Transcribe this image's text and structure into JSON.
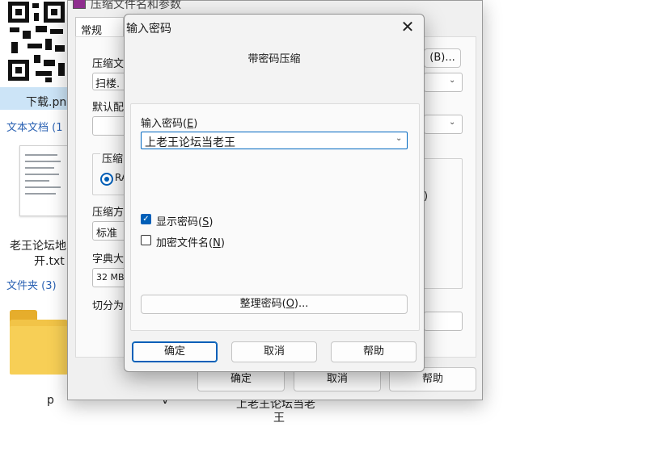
{
  "explorer": {
    "file_qr_label": "下载.pn",
    "group_text_docs": "文本文档 (1",
    "doc_label_line1": "老王论坛地",
    "doc_label_line2": "开.txt",
    "group_folders": "文件夹 (3)",
    "folder_label": "p",
    "folder_label2": "v",
    "bottom_text_line1": "上老王论坛当老",
    "bottom_text_line2": "王"
  },
  "back_dialog": {
    "title": "压缩文件名和参数",
    "tab_general": "常规",
    "archive_name_label": "压缩文",
    "archive_name_value": "扫楼.",
    "browse_button": "(B)...",
    "profile_label": "默认配",
    "format_group_label": "压缩",
    "format_rar": "RA",
    "method_label": "压缩方",
    "method_value": "标准",
    "dict_label": "字典大",
    "dict_value": "32 MB",
    "split_label": "切分为",
    "partial_right_char": ")",
    "ok_button": "确定",
    "cancel_button": "取消",
    "help_button": "帮助"
  },
  "pw_dialog": {
    "title": "输入密码",
    "close_glyph": "✕",
    "subtitle": "带密码压缩",
    "enter_label": "输入密码(",
    "enter_hotkey": "E",
    "enter_label_end": ")",
    "password_value": "上老王论坛当老王",
    "show_pw_label": "显示密码(",
    "show_pw_hotkey": "S",
    "show_pw_end": ")",
    "show_pw_checked": true,
    "encrypt_names_label": "加密文件名(",
    "encrypt_names_hotkey": "N",
    "encrypt_names_end": ")",
    "encrypt_names_checked": false,
    "organize_label": "整理密码(",
    "organize_hotkey": "O",
    "organize_end": ")...",
    "ok_button": "确定",
    "cancel_button": "取消",
    "help_button": "帮助",
    "checkmark_glyph": "✓",
    "chevron_glyph": "⌄"
  },
  "colors": {
    "accent": "#005fb8",
    "selection": "#cce4f7"
  }
}
